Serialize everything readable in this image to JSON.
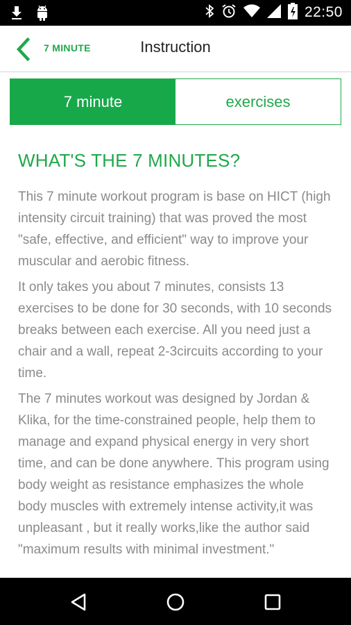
{
  "status_bar": {
    "time": "22:50",
    "left_icons": [
      "download-icon",
      "android-icon"
    ],
    "right_icons": [
      "bluetooth-icon",
      "alarm-icon",
      "wifi-icon",
      "signal-icon",
      "battery-icon"
    ]
  },
  "app_bar": {
    "back_icon": "chevron-left-icon",
    "brand": "7 MINUTE",
    "title": "Instruction"
  },
  "tabs": [
    {
      "label": "7 minute",
      "active": true
    },
    {
      "label": "exercises",
      "active": false
    }
  ],
  "content": {
    "heading": "WHAT'S THE 7 MINUTES?",
    "paragraphs": [
      "This 7 minute workout program is base on HICT (high intensity circuit training) that was proved the most \"safe, effective, and efficient\" way to improve your muscular and aerobic fitness.",
      "It only takes you about 7 minutes, consists 13 exercises to be done for 30 seconds, with 10 seconds breaks between each exercise. All you need just a chair and a wall, repeat 2-3circuits according to your time.",
      "The 7 minutes workout was designed by Jordan & Klika, for the time-constrained people, help them to manage and expand physical energy in very short time, and can be done anywhere. This program using body weight as resistance emphasizes the whole body muscles with extremely intense activity,it was unpleasant , but it really works,like the author said \"maximum results with minimal investment.\""
    ]
  },
  "nav_bar": {
    "icons": [
      "back-triangle-icon",
      "home-circle-icon",
      "recents-square-icon"
    ]
  },
  "colors": {
    "accent": "#1fa84a",
    "text_gray": "#8a8a8a",
    "bars": "#000000"
  }
}
